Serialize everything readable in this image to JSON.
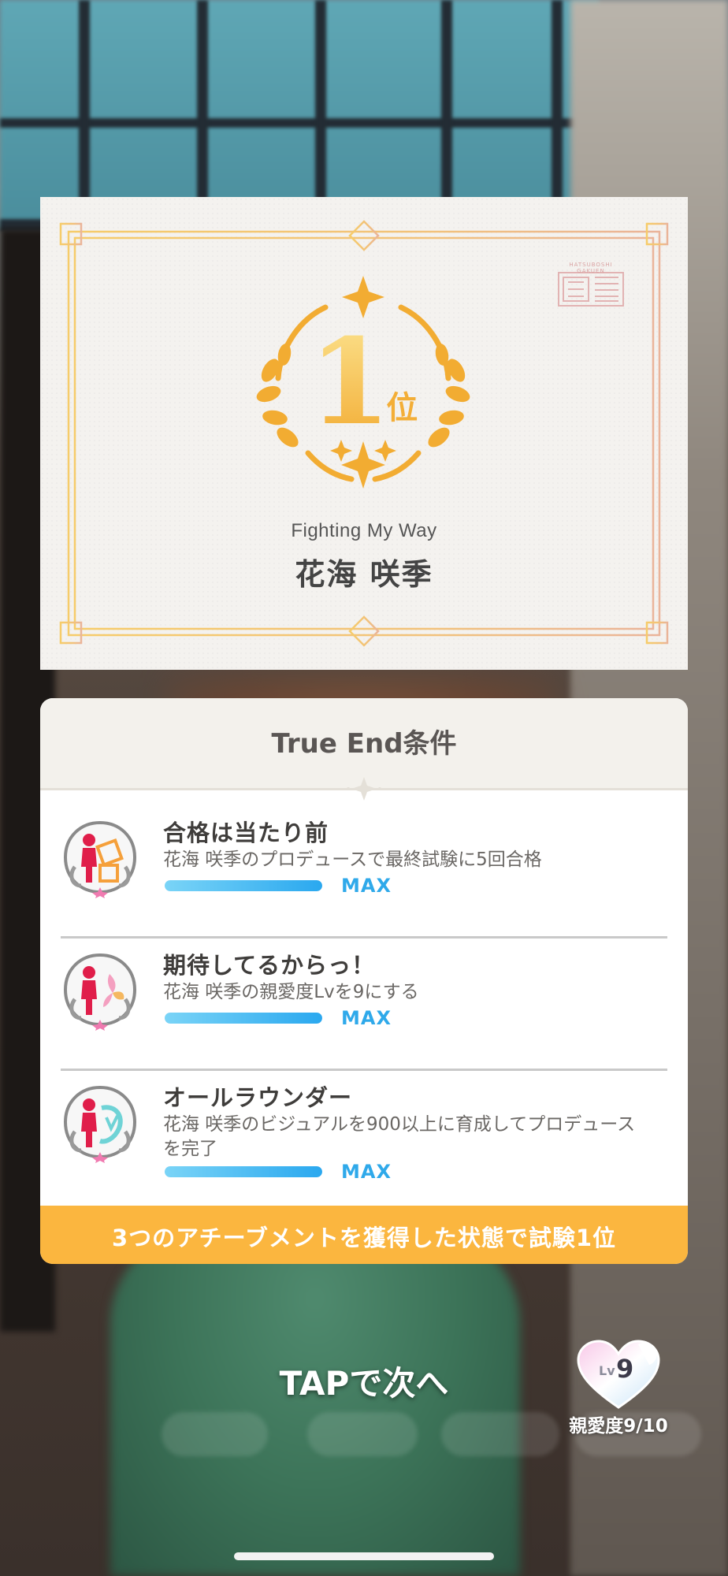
{
  "certificate": {
    "rank_number": "1",
    "rank_suffix": "位",
    "seal_text": "HATSUBOSHI GAKUEN",
    "song_title": "Fighting My Way",
    "idol_name": "花海 咲季"
  },
  "conditions": {
    "title": "True End条件",
    "achievements": [
      {
        "title": "合格は当たり前",
        "description": "花海 咲季のプロデュースで最終試験に5回合格",
        "progress": 1.0,
        "status": "MAX",
        "badge_icon": "exam-badge-icon"
      },
      {
        "title": "期待してるからっ！",
        "description": "花海 咲季の親愛度Lvを9にする",
        "progress": 1.0,
        "status": "MAX",
        "badge_icon": "affection-badge-icon"
      },
      {
        "title": "オールラウンダー",
        "description": "花海 咲季のビジュアルを900以上に育成してプロデュースを完了",
        "progress": 1.0,
        "status": "MAX",
        "badge_icon": "visual-badge-icon"
      }
    ],
    "footer": "3つのアチーブメントを獲得した状態で試験1位"
  },
  "controls": {
    "tap_prompt": "TAPで次へ",
    "affinity_lv_prefix": "Lv",
    "affinity_lv_value": "9",
    "affinity_label": "親愛度9/10"
  },
  "colors": {
    "gold": "#f3ae37",
    "max_blue": "#2fa9ea",
    "footer_orange": "#fbb63f"
  }
}
